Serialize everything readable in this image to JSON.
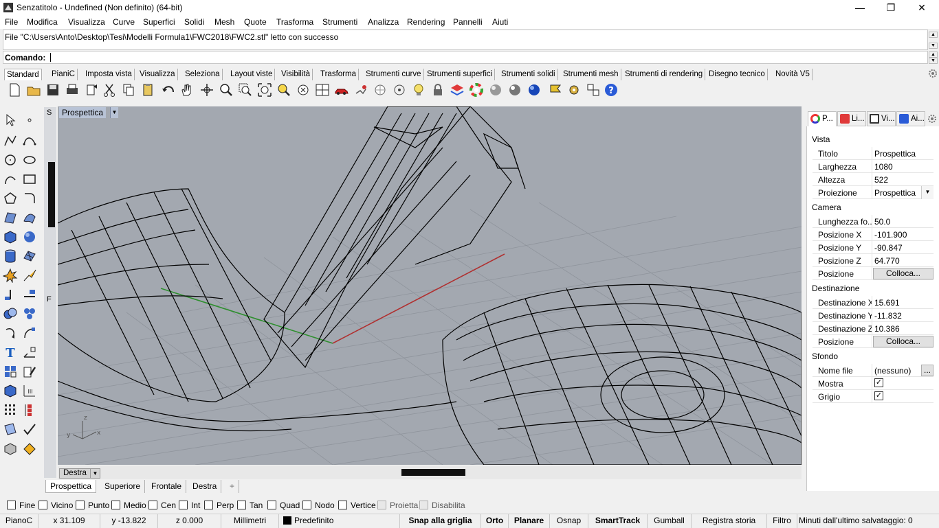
{
  "titlebar": {
    "title": "Senzatitolo - Undefined (Non definito) (64-bit)",
    "minimize": "—",
    "restore": "❐",
    "close": "✕"
  },
  "menu": [
    "File",
    "Modifica",
    "Visualizza",
    "Curve",
    "Superfici",
    "Solidi",
    "Mesh",
    "Quote",
    "Trasforma",
    "Strumenti",
    "Analizza",
    "Rendering",
    "Pannelli",
    "Aiuti"
  ],
  "command": {
    "history": "File \"C:\\Users\\Anto\\Desktop\\Tesi\\Modelli Formula1\\FWC2018\\FWC2.stl\" letto con successo",
    "prompt": "Comando:"
  },
  "toolbar_tabs": [
    "Standard",
    "PianiC",
    "Imposta vista",
    "Visualizza",
    "Seleziona",
    "Layout viste",
    "Visibilità",
    "Trasforma",
    "Strumenti curve",
    "Strumenti superfici",
    "Strumenti solidi",
    "Strumenti mesh",
    "Strumenti di rendering",
    "Disegno tecnico",
    "Novità V5"
  ],
  "viewport": {
    "active_label": "Prospettica",
    "secondary_label": "Destra",
    "sidebar_letters": [
      "S",
      "F"
    ]
  },
  "view_tabs": [
    "Prospettica",
    "Superiore",
    "Frontale",
    "Destra",
    "+"
  ],
  "axes": {
    "x": "x",
    "y": "y",
    "z": "z"
  },
  "panel": {
    "tabs": [
      "P...",
      "Li...",
      "Vi...",
      "Ai..."
    ],
    "vista": {
      "header": "Vista",
      "rows": [
        [
          "Titolo",
          "Prospettica"
        ],
        [
          "Larghezza",
          "1080"
        ],
        [
          "Altezza",
          "522"
        ],
        [
          "Proiezione",
          "Prospettica"
        ]
      ]
    },
    "camera": {
      "header": "Camera",
      "rows": [
        [
          "Lunghezza fo...",
          "50.0"
        ],
        [
          "Posizione X",
          "-101.900"
        ],
        [
          "Posizione Y",
          "-90.847"
        ],
        [
          "Posizione Z",
          "64.770"
        ]
      ],
      "pos_label": "Posizione",
      "pos_button": "Colloca..."
    },
    "destinazione": {
      "header": "Destinazione",
      "rows": [
        [
          "Destinazione X",
          "15.691"
        ],
        [
          "Destinazione Y",
          "-11.832"
        ],
        [
          "Destinazione Z",
          "10.386"
        ]
      ],
      "pos_label": "Posizione",
      "pos_button": "Colloca..."
    },
    "sfondo": {
      "header": "Sfondo",
      "file_label": "Nome file",
      "file_value": "(nessuno)",
      "file_btn": "...",
      "mostra": "Mostra",
      "grigio": "Grigio"
    }
  },
  "osnap": [
    "Fine",
    "Vicino",
    "Punto",
    "Medio",
    "Cen",
    "Int",
    "Perp",
    "Tan",
    "Quad",
    "Nodo",
    "Vertice"
  ],
  "osnap_disabled": [
    "Proietta",
    "Disabilita"
  ],
  "status": {
    "plane": "PianoC",
    "x": "x 31.109",
    "y": "y -13.822",
    "z": "z 0.000",
    "units": "Millimetri",
    "layer": "Predefinito",
    "snap": "Snap alla griglia",
    "ortho": "Orto",
    "planar": "Planare",
    "osnap": "Osnap",
    "smarttrack": "SmartTrack",
    "gumball": "Gumball",
    "history": "Registra storia",
    "filter": "Filtro",
    "saved": "Minuti dall'ultimo salvataggio: 0"
  },
  "colors": {
    "viewport_bg": "#a3a8b0",
    "grid": "#8f949c",
    "x_axis": "#b03030",
    "y_axis": "#2f8f2f",
    "label_bg": "#b8c3d6"
  }
}
